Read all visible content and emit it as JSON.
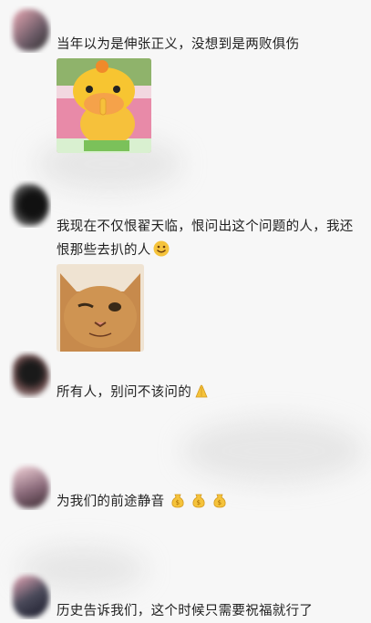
{
  "chat": {
    "messages": [
      {
        "text": "当年以为是伸张正义，没想到是两败俱伤",
        "sticker": "yellow-cartoon-shush-sticker"
      },
      {
        "text": "我现在不仅恨翟天临，恨问出这个问题的人，我还恨那些去扒的人",
        "emoji": "smiling-face-emoji",
        "sticker": "squinting-cat-sticker"
      },
      {
        "text": "所有人，别问不该问的",
        "emoji": "folded-hands-emoji"
      },
      {
        "text": "为我们的前途静音",
        "emoji": "money-bag-emoji",
        "emoji_count": 3
      },
      {
        "text": "历史告诉我们，这个时候只需要祝福就行了"
      }
    ]
  },
  "colors": {
    "background": "#f7f7f7",
    "text": "#1f1f1f",
    "emoji_yellow": "#f5c33b"
  }
}
